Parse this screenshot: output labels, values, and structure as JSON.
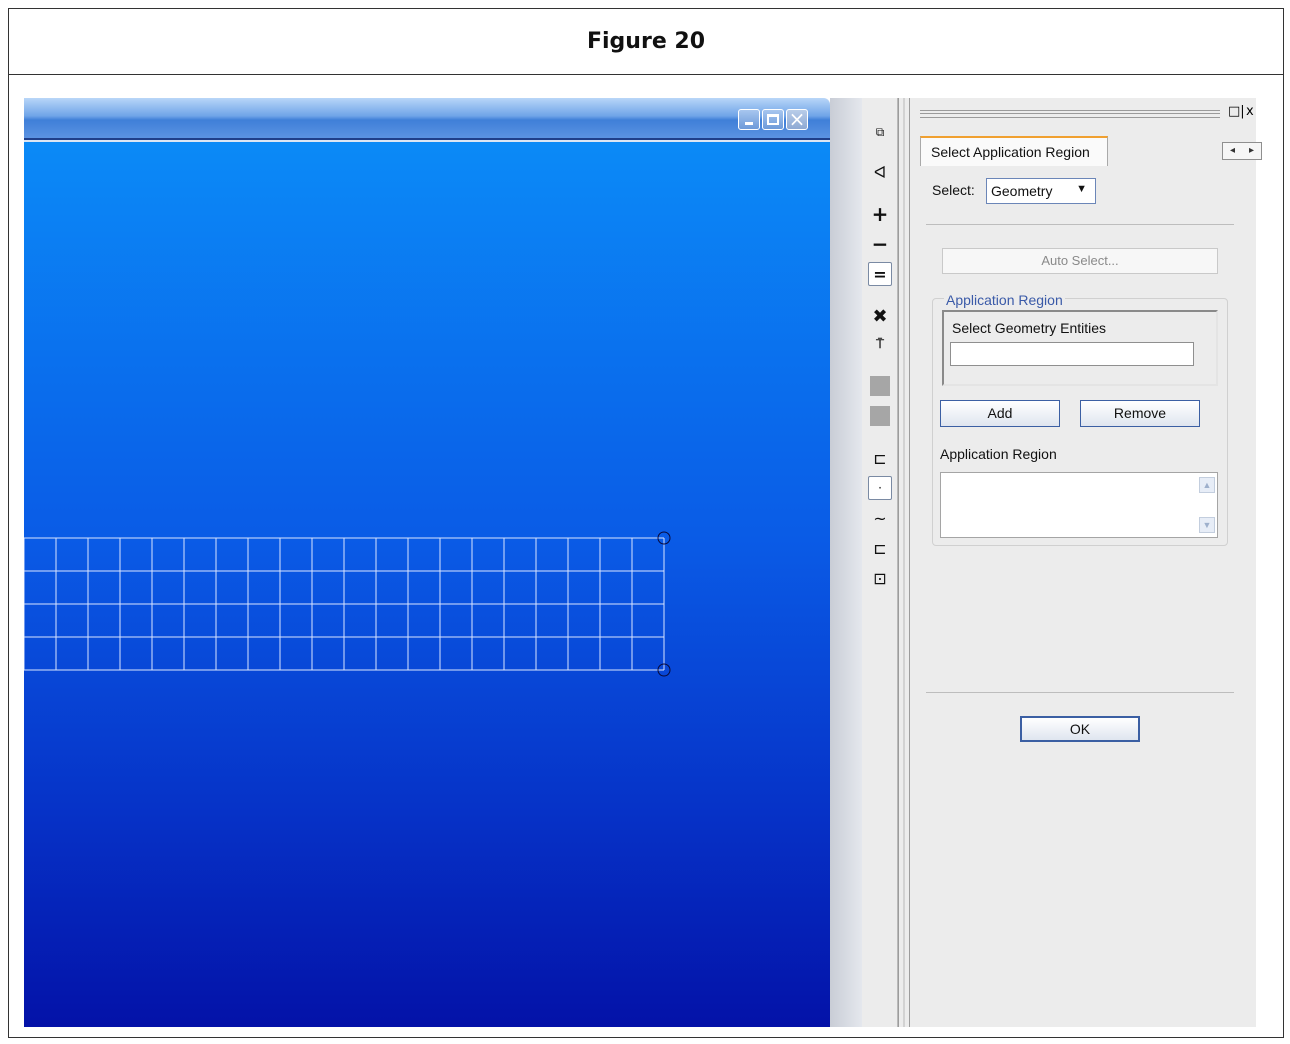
{
  "figure": {
    "title": "Figure 20"
  },
  "viewport": {
    "window_buttons": {
      "minimize": "minimize",
      "maximize": "maximize",
      "close": "close"
    },
    "background_top": "#0b8af7",
    "background_bottom": "#0412a8",
    "mesh": {
      "rows": 4,
      "columns": 20,
      "line_color": "#d9e4ff"
    }
  },
  "toolbar": {
    "icons": [
      "probe-icon",
      "polygon-select-icon",
      "add-icon",
      "subtract-icon",
      "equals-icon",
      "clear-selection-icon",
      "pick-filter-icon",
      "node-color-icon",
      "element-color-icon",
      "face-select-icon",
      "point-select-icon",
      "curve-select-icon",
      "surface-select-icon",
      "solid-select-icon"
    ]
  },
  "panel": {
    "controls": {
      "float": "□|",
      "close": "x"
    },
    "tab_label": "Select Application Region",
    "tab_nav": {
      "prev": "◂",
      "next": "▸"
    },
    "select_label": "Select:",
    "select_value": "Geometry",
    "auto_select_label": "Auto Select...",
    "group_title": "Application Region",
    "entities_label": "Select Geometry Entities",
    "entities_value": "",
    "add_label": "Add",
    "remove_label": "Remove",
    "region_list_label": "Application Region",
    "ok_label": "OK"
  }
}
